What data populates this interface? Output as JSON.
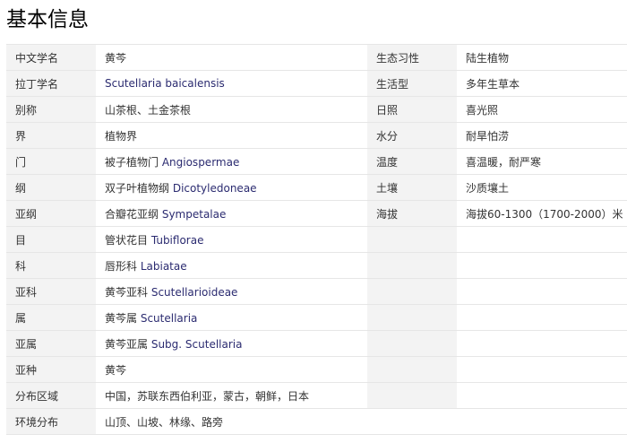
{
  "title": "基本信息",
  "left": [
    {
      "label": "中文学名",
      "value": "黄芩",
      "latin": ""
    },
    {
      "label": "拉丁学名",
      "value": "",
      "latin": "Scutellaria baicalensis"
    },
    {
      "label": "别称",
      "value": "山茶根、土金茶根",
      "latin": ""
    },
    {
      "label": "界",
      "value": "植物界",
      "latin": ""
    },
    {
      "label": "门",
      "value": "被子植物门 ",
      "latin": "Angiospermae"
    },
    {
      "label": "纲",
      "value": "双子叶植物纲 ",
      "latin": "Dicotyledoneae"
    },
    {
      "label": "亚纲",
      "value": "合瓣花亚纲 ",
      "latin": "Sympetalae"
    },
    {
      "label": "目",
      "value": "管状花目 ",
      "latin": "Tubiflorae"
    },
    {
      "label": "科",
      "value": "唇形科 ",
      "latin": "Labiatae"
    },
    {
      "label": "亚科",
      "value": "黄芩亚科 ",
      "latin": "Scutellarioideae"
    },
    {
      "label": "属",
      "value": "黄芩属 ",
      "latin": "Scutellaria"
    },
    {
      "label": "亚属",
      "value": "黄芩亚属 ",
      "latin": "Subg. Scutellaria"
    },
    {
      "label": "亚种",
      "value": "黄芩",
      "latin": ""
    },
    {
      "label": "分布区域",
      "value": "中国，苏联东西伯利亚，蒙古，朝鲜，日本",
      "latin": ""
    },
    {
      "label": "环境分布",
      "value": "山顶、山坡、林缘、路旁",
      "latin": ""
    }
  ],
  "right": [
    {
      "label": "生态习性",
      "value": "陆生植物"
    },
    {
      "label": "生活型",
      "value": "多年生草本"
    },
    {
      "label": "日照",
      "value": "喜光照"
    },
    {
      "label": "水分",
      "value": "耐旱怕涝"
    },
    {
      "label": "温度",
      "value": "喜温暖，耐严寒"
    },
    {
      "label": "土壤",
      "value": "沙质壤土"
    },
    {
      "label": "海拔",
      "value": "海拔60-1300（1700-2000）米"
    }
  ]
}
